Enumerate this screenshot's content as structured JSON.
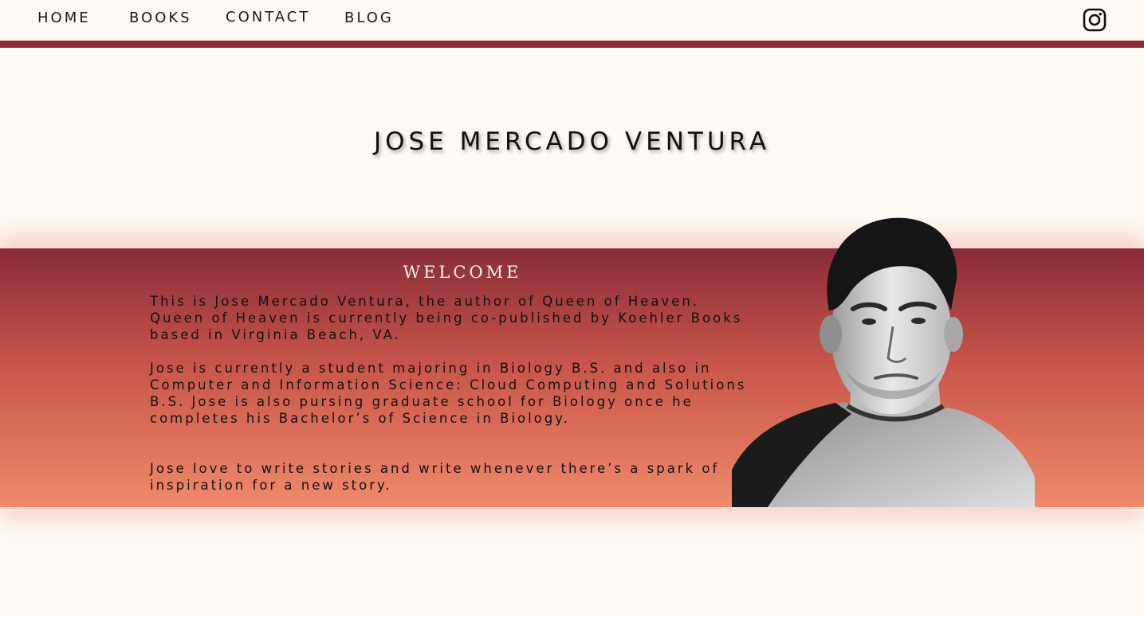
{
  "nav": {
    "items": [
      {
        "label": "HOME"
      },
      {
        "label": "BOOKS"
      },
      {
        "label": "CONTACT"
      },
      {
        "label": "BLOG"
      }
    ],
    "social_icon": "instagram-icon"
  },
  "header": {
    "title": "JOSE MERCADO VENTURA"
  },
  "welcome": {
    "heading": "WELCOME",
    "paragraphs": [
      "This is Jose Mercado Ventura, the author of Queen of Heaven. Queen of Heaven is currently  being co-published by Koehler Books based in Virginia Beach, VA.",
      "Jose is currently a student majoring in Biology B.S. and also in Computer and Information Science: Cloud Computing and Solutions B.S. Jose is also pursing graduate school for Biology once he completes his Bachelor’s of Science in Biology.",
      "Jose love to write stories and write whenever there’s a spark of inspiration for a new story."
    ]
  },
  "colors": {
    "background": "#fffaf3",
    "accent": "#8b2a35",
    "gradient_top": "#882c38",
    "gradient_bottom": "#f08a6a"
  }
}
